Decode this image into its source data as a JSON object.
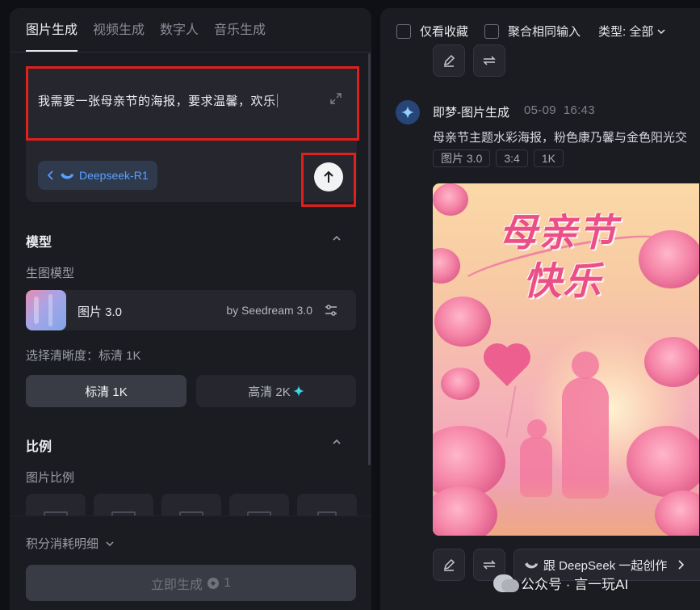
{
  "left_panel": {
    "tabs": [
      "图片生成",
      "视频生成",
      "数字人",
      "音乐生成"
    ],
    "prompt": {
      "text": "我需要一张母亲节的海报，要求温馨，欢乐"
    },
    "model_chip": {
      "label": "Deepseek-R1"
    },
    "model_section": {
      "title": "模型",
      "subtitle": "生图模型",
      "model_name": "图片 3.0",
      "model_by": "by Seedream 3.0"
    },
    "resolution": {
      "label": "选择清晰度：标清 1K",
      "options": [
        "标清 1K",
        "高清 2K"
      ],
      "selected": "标清 1K"
    },
    "ratio_section": {
      "title": "比例",
      "subtitle": "图片比例"
    },
    "credit_label": "积分消耗明细",
    "generate_button": {
      "label": "立即生成",
      "cost": "1"
    }
  },
  "right_panel": {
    "filters": {
      "favorites_only": "仅看收藏",
      "aggregate_same_input": "聚合相同输入",
      "type_select": "类型: 全部"
    },
    "post": {
      "author": "即梦-图片生成",
      "date": "05-09",
      "time": "16:43",
      "description": "母亲节主题水彩海报，粉色康乃馨与金色阳光交",
      "tags": [
        "图片 3.0",
        "3:4",
        "1K"
      ],
      "poster_title_line1": "母亲节",
      "poster_title_line2": "快乐"
    },
    "deepseek_button": {
      "label": "跟 DeepSeek 一起创作"
    },
    "watermark": "公众号 · 言一玩AI"
  },
  "colors": {
    "highlight_box": "#e0201c",
    "accent_blue": "#5aa0ff",
    "accent_cyan": "#27c3d6"
  },
  "icons": [
    "expand-icon",
    "whale-icon",
    "chevron-left-icon",
    "arrow-up-icon",
    "chevron-up-icon",
    "sliders-icon",
    "sparkle-icon",
    "chevron-down-icon",
    "coin-icon",
    "pencil-icon",
    "regenerate-icon",
    "avatar-star-icon",
    "chevron-right-icon",
    "wechat-icon"
  ]
}
